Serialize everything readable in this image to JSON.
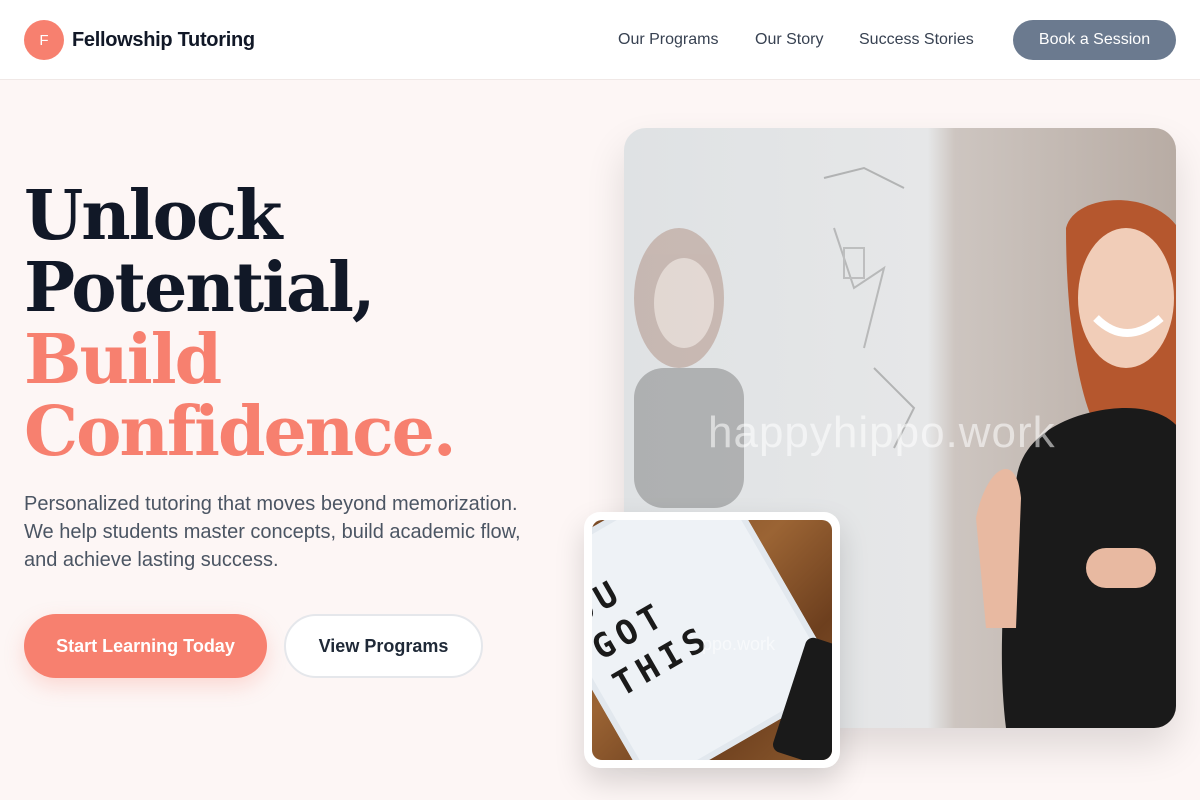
{
  "header": {
    "logo_letter": "F",
    "brand": "Fellowship Tutoring",
    "nav": {
      "programs": "Our Programs",
      "story": "Our Story",
      "success": "Success Stories"
    },
    "cta": "Book a Session"
  },
  "hero": {
    "title": {
      "line1": "Unlock",
      "line2": "Potential,",
      "line3": "Build",
      "line4": "Confidence."
    },
    "subtitle": "Personalized tutoring that moves beyond memorization. We help students master concepts, build academic flow, and achieve lasting success.",
    "primary_button": "Start Learning Today",
    "secondary_button": "View Programs"
  },
  "images": {
    "main_watermark": "happyhippo.work",
    "inset_watermark": "ppo.work",
    "lightbox_text": "OU\nGOT\nTHIS"
  },
  "colors": {
    "accent": "#f7806f",
    "dark": "#111827",
    "nav_button": "#6b7a8f"
  }
}
